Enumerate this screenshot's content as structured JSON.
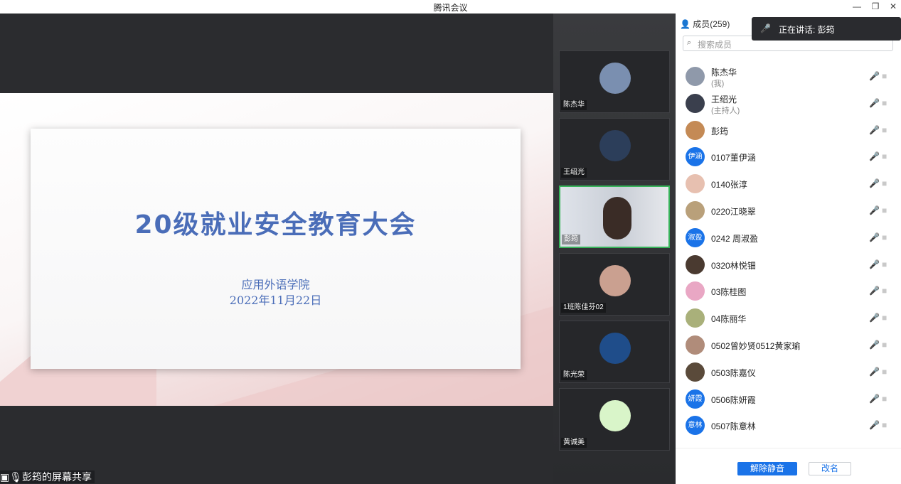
{
  "window": {
    "title": "腾讯会议",
    "minimize": "—",
    "restore": "❐",
    "close": "✕"
  },
  "slide": {
    "title": "20级就业安全教育大会",
    "org": "应用外语学院",
    "date": "2022年11月22日"
  },
  "share_label": "彭筠的屏幕共享",
  "video_tiles": [
    {
      "name": "陈杰华",
      "avatar_color": "#7a8fb0"
    },
    {
      "name": "王绍光",
      "avatar_color": "#2c3e5a"
    },
    {
      "name": "彭筠",
      "avatar_color": "#d6d8dc"
    },
    {
      "name": "1班陈佳芬02",
      "avatar_color": "#caa090"
    },
    {
      "name": "陈光荣",
      "avatar_color": "#1f4d8a"
    },
    {
      "name": "黄诚美",
      "avatar_color": "#d9f5c9"
    }
  ],
  "panel": {
    "header": "成员(259)",
    "search_placeholder": "搜索成员",
    "members": [
      {
        "name": "陈杰华",
        "role": "(我)",
        "avatar_text": "",
        "color": "#8f99aa"
      },
      {
        "name": "王绍光",
        "role": "(主持人)",
        "avatar_text": "",
        "color": "#3a3f4d"
      },
      {
        "name": "彭筠",
        "role": "",
        "avatar_text": "",
        "color": "#c48a55"
      },
      {
        "name": "0107董伊涵",
        "role": "",
        "avatar_text": "伊涵",
        "color": "#1a73e8"
      },
      {
        "name": "0140张淳",
        "role": "",
        "avatar_text": "",
        "color": "#e7c0b0"
      },
      {
        "name": "0220江晓翠",
        "role": "",
        "avatar_text": "",
        "color": "#b9a07a"
      },
      {
        "name": "0242 周淑盈",
        "role": "",
        "avatar_text": "淑盈",
        "color": "#1a73e8"
      },
      {
        "name": "0320林悦钿",
        "role": "",
        "avatar_text": "",
        "color": "#4a3a30"
      },
      {
        "name": "03陈桂图",
        "role": "",
        "avatar_text": "",
        "color": "#e9a7c4"
      },
      {
        "name": "04陈丽华",
        "role": "",
        "avatar_text": "",
        "color": "#a9b07a"
      },
      {
        "name": "0502曾妙贤0512黄家瑜",
        "role": "",
        "avatar_text": "",
        "color": "#b08c7a"
      },
      {
        "name": "0503陈嘉仪",
        "role": "",
        "avatar_text": "",
        "color": "#5a4a3a"
      },
      {
        "name": "0506陈妍霞",
        "role": "",
        "avatar_text": "妍霞",
        "color": "#1a73e8"
      },
      {
        "name": "0507陈意林",
        "role": "",
        "avatar_text": "意林",
        "color": "#1a73e8"
      }
    ],
    "mute_all": "解除静音",
    "rename": "改名"
  },
  "speaking": {
    "label": "正在讲话: 彭筠"
  },
  "icons": {
    "mic": "🎤",
    "cam": "■",
    "search": "🔍"
  }
}
